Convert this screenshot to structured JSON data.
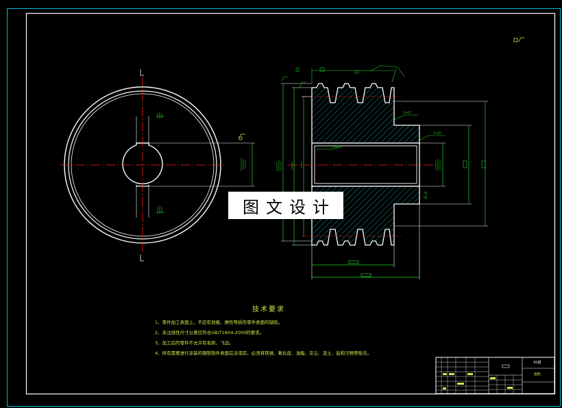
{
  "watermark": "图文设计",
  "technical_requirements": {
    "title": "技术要求",
    "items": [
      "1、零件加工表面上，不应有划痕、擦伤等损伤零件表面的缺陷。",
      "2、未注线性尺寸公差应符合GB/T1804-2000的要求。",
      "3、加工后的零件不允许有毛刺、飞边。",
      "4、所有需要进行涂装的钢铁制件表面在涂漆前，必须将铁锈、氧化皮、油脂、灰尘、泥土、盐和污物等除去。"
    ]
  },
  "title_block": {
    "material": "45钢",
    "part_name": "齿轮"
  },
  "colors": {
    "frame": "#ffffff",
    "outer_border": "#00bcd4",
    "center_line": "#ff2020",
    "dimension": "#27d427",
    "hatch": "#18b8b8",
    "note_text": "#d4e84a"
  }
}
